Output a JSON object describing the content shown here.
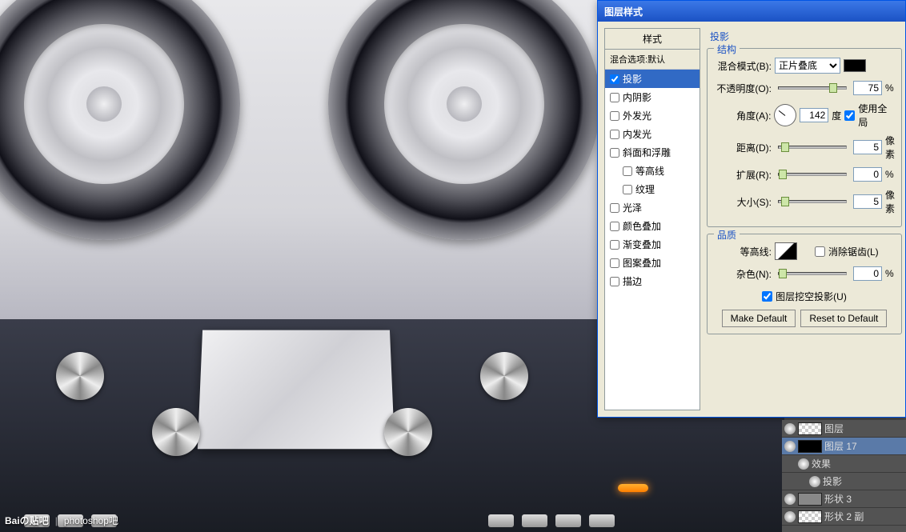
{
  "dialog": {
    "title": "图层样式",
    "styles_header": "样式",
    "blend_default": "混合选项:默认",
    "effects": {
      "dropshadow": "投影",
      "innershadow": "内阴影",
      "outerglow": "外发光",
      "innerglow": "内发光",
      "bevel": "斜面和浮雕",
      "contour": "等高线",
      "texture": "纹理",
      "satin": "光泽",
      "coloroverlay": "颜色叠加",
      "gradoverlay": "渐变叠加",
      "patoverlay": "图案叠加",
      "stroke": "描边"
    },
    "panel": {
      "name": "投影",
      "group_structure": "结构",
      "group_quality": "品质",
      "mode_label": "混合模式(B):",
      "mode_value": "正片叠底",
      "opacity_label": "不透明度(O):",
      "opacity": "75",
      "angle_label": "角度(A):",
      "angle": "142",
      "deg": "度",
      "useglobal": "使用全局",
      "distance_label": "距离(D):",
      "distance": "5",
      "px": "像素",
      "spread_label": "扩展(R):",
      "spread": "0",
      "size_label": "大小(S):",
      "size": "5",
      "contour_label": "等高线:",
      "antialias": "消除锯齿(L)",
      "noise_label": "杂色(N):",
      "noise": "0",
      "knockout": "图层挖空投影(U)",
      "make_default": "Make Default",
      "reset_default": "Reset to Default",
      "pct": "%"
    }
  },
  "layers": {
    "r0": "图层",
    "r1": "图层 17",
    "r2": "效果",
    "r3": "投影",
    "r4": "形状 3",
    "r5": "形状 2 副"
  },
  "watermark": {
    "logo": "Baiの贴吧",
    "sep": "|",
    "text": "photoshop吧"
  }
}
